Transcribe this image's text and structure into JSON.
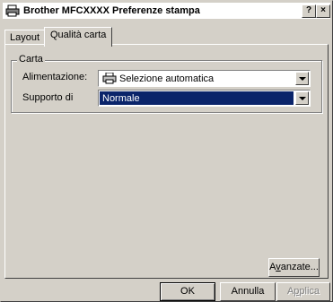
{
  "window": {
    "title": "Brother MFCXXXX Preferenze stampa",
    "help_label": "?",
    "close_label": "×"
  },
  "tabs": [
    {
      "label": "Layout",
      "selected": false
    },
    {
      "label": "Qualità carta",
      "selected": true
    }
  ],
  "paper_group": {
    "title": "Carta",
    "feed": {
      "label": "Alimentazione:",
      "value": "Selezione automatica",
      "icon": "printer-icon"
    },
    "media": {
      "label": "Supporto di",
      "value": "Normale"
    }
  },
  "buttons": {
    "advanced_prefix": "A",
    "advanced_mnemonic": "v",
    "advanced_suffix": "anzate...",
    "ok": "OK",
    "cancel": "Annulla",
    "apply_prefix": "A",
    "apply_mnemonic": "p",
    "apply_suffix": "plica"
  }
}
